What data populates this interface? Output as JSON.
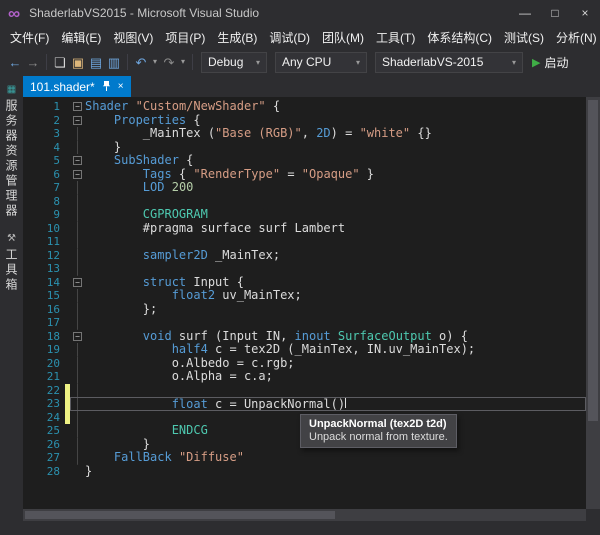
{
  "colors": {
    "accent": "#007ACC",
    "chrome_bg": "#2d2d30",
    "editor_bg": "#1e1e1e",
    "line_number": "#2B91AF",
    "keyword": "#569CD6",
    "string": "#D69D85",
    "type": "#4EC9B0",
    "number": "#B5CEA8",
    "changed_bar": "#EFF284",
    "run_green": "#3fae46"
  },
  "window": {
    "title": "ShaderlabVS2015 - Microsoft Visual Studio",
    "logo_glyph": "∞",
    "controls": [
      {
        "name": "minimize",
        "glyph": "—"
      },
      {
        "name": "maximize",
        "glyph": "□"
      },
      {
        "name": "close",
        "glyph": "×"
      }
    ]
  },
  "menu": {
    "items": [
      "文件(F)",
      "编辑(E)",
      "视图(V)",
      "项目(P)",
      "生成(B)",
      "调试(D)",
      "团队(M)",
      "工具(T)",
      "体系结构(C)",
      "测试(S)",
      "分析(N)"
    ]
  },
  "toolbar": {
    "icons": [
      {
        "name": "back-icon",
        "glyph": "←",
        "style": "blue"
      },
      {
        "name": "forward-icon",
        "glyph": "→",
        "style": "dim"
      },
      {
        "name": "sep"
      },
      {
        "name": "new-file-icon",
        "glyph": "❏",
        "style": "light"
      },
      {
        "name": "open-file-icon",
        "glyph": "▣",
        "style": "gold"
      },
      {
        "name": "save-icon",
        "glyph": "▤",
        "style": "blue"
      },
      {
        "name": "save-all-icon",
        "glyph": "▥",
        "style": "blue"
      },
      {
        "name": "sep"
      },
      {
        "name": "undo-icon",
        "glyph": "↶",
        "style": "blue"
      },
      {
        "name": "undo-chevron-icon",
        "glyph": "▾",
        "style": "chev"
      },
      {
        "name": "redo-icon",
        "glyph": "↷",
        "style": "dim"
      },
      {
        "name": "redo-chevron-icon",
        "glyph": "▾",
        "style": "chev"
      },
      {
        "name": "sep"
      }
    ],
    "config": "Debug",
    "platform": "Any CPU",
    "startup_project": "ShaderlabVS-2015",
    "run_glyph": "▶",
    "run_label": "启动"
  },
  "side_rail": {
    "tabs": [
      {
        "label": "服务器资源管理器",
        "icon": "server-explorer-icon",
        "glyph": "▦",
        "style": "teal"
      },
      {
        "label": "工具箱",
        "icon": "toolbox-icon",
        "glyph": "⚒",
        "style": "dim"
      }
    ]
  },
  "tabs": [
    {
      "label": "101.shader*",
      "active": true,
      "close_glyph": "×"
    }
  ],
  "tooltip": {
    "signature": "UnpackNormal (tex2D t2d)",
    "description": "Unpack normal from texture."
  },
  "editor": {
    "lines": [
      {
        "num": 1,
        "indent": 0,
        "fold": true,
        "tokens": [
          [
            "k",
            "Shader"
          ],
          [
            "d",
            " "
          ],
          [
            "s",
            "\"Custom/NewShader\""
          ],
          [
            "d",
            " {"
          ]
        ]
      },
      {
        "num": 2,
        "indent": 1,
        "fold": true,
        "tokens": [
          [
            "k",
            "Properties"
          ],
          [
            "d",
            " {"
          ]
        ]
      },
      {
        "num": 3,
        "indent": 2,
        "tokens": [
          [
            "d",
            "_MainTex ("
          ],
          [
            "s",
            "\"Base (RGB)\""
          ],
          [
            "d",
            ", "
          ],
          [
            "k",
            "2D"
          ],
          [
            "d",
            ") = "
          ],
          [
            "s",
            "\"white\""
          ],
          [
            "d",
            " {}"
          ]
        ]
      },
      {
        "num": 4,
        "indent": 1,
        "tokens": [
          [
            "d",
            "}"
          ]
        ]
      },
      {
        "num": 5,
        "indent": 1,
        "fold": true,
        "tokens": [
          [
            "k",
            "SubShader"
          ],
          [
            "d",
            " {"
          ]
        ]
      },
      {
        "num": 6,
        "indent": 2,
        "fold": true,
        "tokens": [
          [
            "k",
            "Tags"
          ],
          [
            "d",
            " { "
          ],
          [
            "s",
            "\"RenderType\""
          ],
          [
            "d",
            " = "
          ],
          [
            "s",
            "\"Opaque\""
          ],
          [
            "d",
            " }"
          ]
        ]
      },
      {
        "num": 7,
        "indent": 2,
        "tokens": [
          [
            "k",
            "LOD"
          ],
          [
            "d",
            " "
          ],
          [
            "n",
            "200"
          ]
        ]
      },
      {
        "num": 8,
        "tokens": []
      },
      {
        "num": 9,
        "indent": 2,
        "tokens": [
          [
            "t",
            "CGPROGRAM"
          ]
        ]
      },
      {
        "num": 10,
        "indent": 2,
        "tokens": [
          [
            "d",
            "#pragma surface surf Lambert"
          ]
        ]
      },
      {
        "num": 11,
        "tokens": []
      },
      {
        "num": 12,
        "indent": 2,
        "tokens": [
          [
            "k",
            "sampler2D"
          ],
          [
            "d",
            " _MainTex;"
          ]
        ]
      },
      {
        "num": 13,
        "tokens": []
      },
      {
        "num": 14,
        "indent": 2,
        "fold": true,
        "tokens": [
          [
            "k",
            "struct"
          ],
          [
            "d",
            " Input {"
          ]
        ]
      },
      {
        "num": 15,
        "indent": 3,
        "tokens": [
          [
            "k",
            "float2"
          ],
          [
            "d",
            " uv_MainTex;"
          ]
        ]
      },
      {
        "num": 16,
        "indent": 2,
        "tokens": [
          [
            "d",
            "};"
          ]
        ]
      },
      {
        "num": 17,
        "tokens": []
      },
      {
        "num": 18,
        "indent": 2,
        "fold": true,
        "tokens": [
          [
            "k",
            "void"
          ],
          [
            "d",
            " surf (Input IN, "
          ],
          [
            "k",
            "inout"
          ],
          [
            "d",
            " "
          ],
          [
            "t",
            "SurfaceOutput"
          ],
          [
            "d",
            " o) {"
          ]
        ]
      },
      {
        "num": 19,
        "indent": 3,
        "tokens": [
          [
            "k",
            "half4"
          ],
          [
            "d",
            " c = tex2D (_MainTex, IN.uv_MainTex);"
          ]
        ]
      },
      {
        "num": 20,
        "indent": 3,
        "tokens": [
          [
            "d",
            "o.Albedo = c.rgb;"
          ]
        ]
      },
      {
        "num": 21,
        "indent": 3,
        "tokens": [
          [
            "d",
            "o.Alpha = c.a;"
          ]
        ]
      },
      {
        "num": 22,
        "changed": true,
        "tokens": []
      },
      {
        "num": 23,
        "indent": 3,
        "changed": true,
        "current": true,
        "caret": true,
        "tokens": [
          [
            "k",
            "float"
          ],
          [
            "d",
            " c = UnpackNormal()"
          ]
        ]
      },
      {
        "num": 24,
        "changed": true,
        "tokens": []
      },
      {
        "num": 25,
        "indent": 3,
        "tokens": [
          [
            "t",
            "ENDCG"
          ]
        ]
      },
      {
        "num": 26,
        "indent": 2,
        "tokens": [
          [
            "d",
            "}"
          ]
        ]
      },
      {
        "num": 27,
        "indent": 1,
        "tokens": [
          [
            "k",
            "FallBack"
          ],
          [
            "d",
            " "
          ],
          [
            "s",
            "\"Diffuse\""
          ]
        ]
      },
      {
        "num": 28,
        "indent": 0,
        "tokens": [
          [
            "d",
            "}"
          ]
        ]
      }
    ]
  }
}
